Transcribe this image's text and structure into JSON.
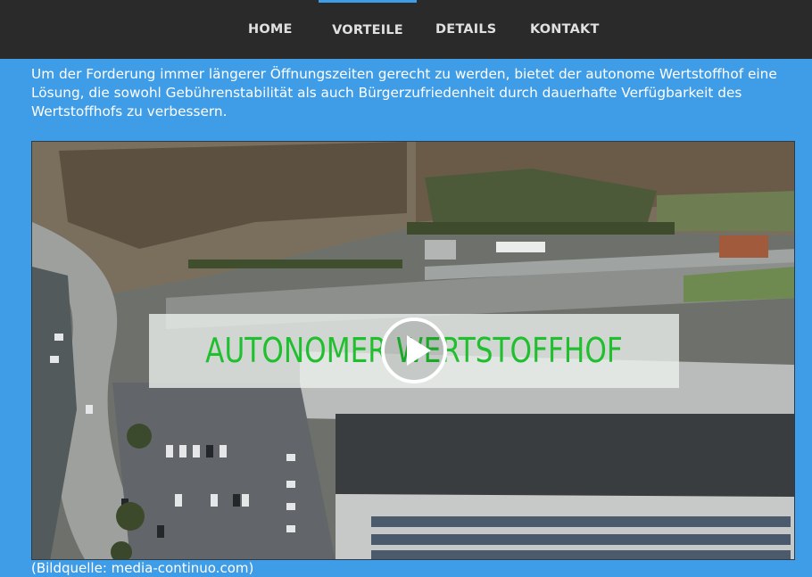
{
  "nav": {
    "items": [
      {
        "label": "HOME"
      },
      {
        "label": "VORTEILE"
      },
      {
        "label": "DETAILS"
      },
      {
        "label": "KONTAKT"
      }
    ]
  },
  "intro": {
    "text": "Um der Forderung immer längerer Öffnungszeiten gerecht zu werden, bietet der autonome Wertstoffhof eine Lösung, die sowohl Gebührenstabilität als auch Bürgerzufriedenheit durch dauerhafte Verfügbarkeit des Wertstoffhofs zu verbessern."
  },
  "video": {
    "title": "AUTONOMER WERTSTOFFHOF",
    "play_icon": "play-icon"
  },
  "caption": {
    "text": "(Bildquelle: media-continuo.com)"
  },
  "colors": {
    "page_background": "#3f9ce6",
    "nav_background": "#2a2a2a",
    "nav_text": "#e0e0e0",
    "active_indicator": "#3f9ce6",
    "video_title": "#1fbf2e"
  }
}
